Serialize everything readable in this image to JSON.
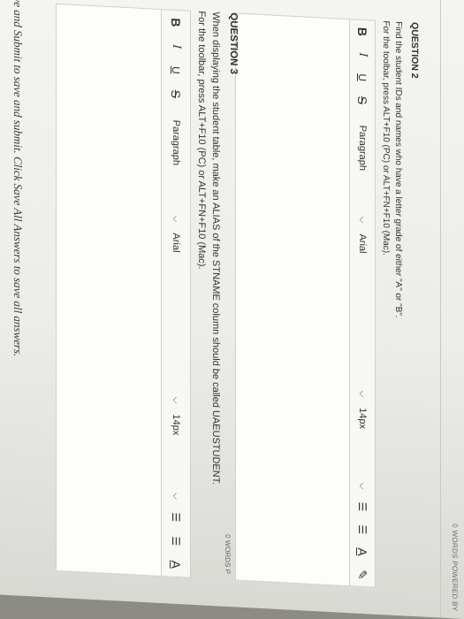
{
  "page": {
    "words_counter_top": "0 WORDS POWERED BY"
  },
  "q2": {
    "title": "QUESTION 2",
    "text_line1": "Find the student IDs and names who have a letter grade of either \"A\" or \"B\".",
    "text_line2": "For the toolbar, press ALT+F10 (PC) or ALT+FN+F10 (Mac).",
    "toolbar": {
      "bold": "B",
      "italic": "I",
      "underline": "U",
      "strike": "S",
      "paragraph": "Paragraph",
      "font": "Arial",
      "size": "14px"
    },
    "words_counter": "0 WORDS P"
  },
  "q3": {
    "title": "QUESTION 3",
    "text_line1": "When displaying the student table, make an ALIAS of the STNAME column should be called UAEUSTUDENT.",
    "text_line2": "For the toolbar, press ALT+F10 (PC) or ALT+FN+F10 (Mac).",
    "toolbar": {
      "bold": "B",
      "italic": "I",
      "underline": "U",
      "strike": "S",
      "paragraph": "Paragraph",
      "font": "Arial",
      "size": "14px",
      "color": "A"
    }
  },
  "footer": {
    "note": "Save and Submit to save and submit. Click Save All Answers to save all answers."
  }
}
